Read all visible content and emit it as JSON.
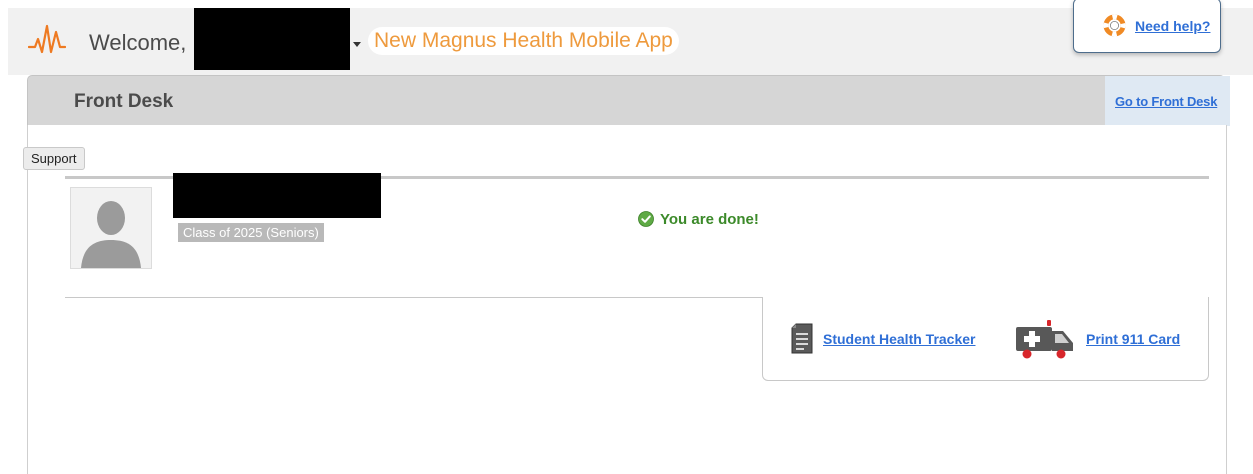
{
  "header": {
    "welcome_label": "Welcome,",
    "announcement": "New Magnus Health Mobile App",
    "help_link": "Need help?",
    "logo_icon": "heartbeat-logo-icon",
    "help_icon": "lifebuoy-icon"
  },
  "front_desk": {
    "title": "Front Desk",
    "go_link": "Go to Front Desk"
  },
  "tooltip": "Support",
  "student": {
    "class_label": "Class of 2025 (Seniors)",
    "status": "You are done!",
    "status_icon": "check-circle-icon",
    "avatar_icon": "default-avatar-icon"
  },
  "links": {
    "tracker": "Student Health Tracker",
    "tracker_icon": "document-icon",
    "print_card": "Print 911 Card",
    "print_card_icon": "ambulance-icon"
  },
  "colors": {
    "accent_orange": "#ee9a3d",
    "link_blue": "#2f6fd6",
    "success_green": "#3c8a2a"
  }
}
